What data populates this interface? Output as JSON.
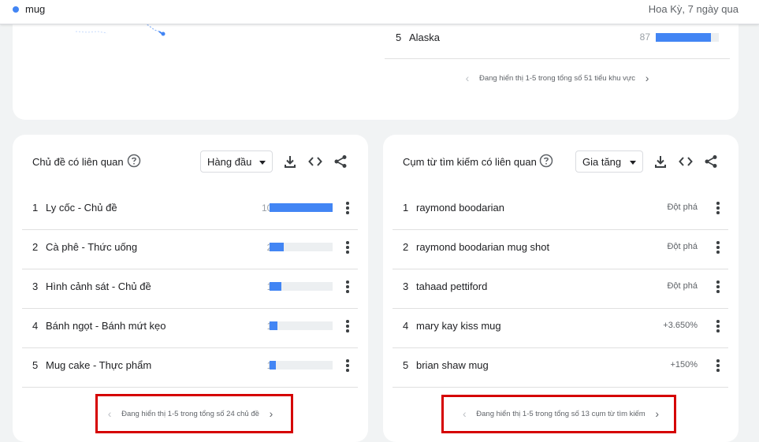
{
  "header": {
    "term": "mug",
    "term_color": "#4285f4",
    "region_time": "Hoa Kỳ, 7 ngày qua"
  },
  "regions": {
    "visible_row": {
      "rank": "5",
      "name": "Alaska",
      "value": "87",
      "fill_percent": 87
    },
    "pager": {
      "prev_icon": "‹",
      "text": "Đang hiển thị 1-5 trong tổng số 51 tiểu khu vực",
      "next_icon": "›"
    }
  },
  "related_topics": {
    "title": "Chủ đề có liên quan",
    "dropdown": "Hàng đầu",
    "rows": [
      {
        "rank": "1",
        "label": "Ly cốc - Chủ đề",
        "value": "100",
        "fill_percent": 100
      },
      {
        "rank": "2",
        "label": "Cà phê - Thức uống",
        "value": "22",
        "fill_percent": 22
      },
      {
        "rank": "3",
        "label": "Hình cảnh sát - Chủ đề",
        "value": "19",
        "fill_percent": 19
      },
      {
        "rank": "4",
        "label": "Bánh ngọt - Bánh mứt kẹo",
        "value": "12",
        "fill_percent": 12
      },
      {
        "rank": "5",
        "label": "Mug cake - Thực phẩm",
        "value": "10",
        "fill_percent": 10
      }
    ],
    "pager": {
      "prev_icon": "‹",
      "text": "Đang hiển thị 1-5 trong tổng số 24 chủ đề",
      "next_icon": "›"
    }
  },
  "related_queries": {
    "title": "Cụm từ tìm kiếm có liên quan",
    "dropdown": "Gia tăng",
    "rows": [
      {
        "rank": "1",
        "label": "raymond boodarian",
        "value": "Đột phá"
      },
      {
        "rank": "2",
        "label": "raymond boodarian mug shot",
        "value": "Đột phá"
      },
      {
        "rank": "3",
        "label": "tahaad pettiford",
        "value": "Đột phá"
      },
      {
        "rank": "4",
        "label": "mary kay kiss mug",
        "value": "+3.650%"
      },
      {
        "rank": "5",
        "label": "brian shaw mug",
        "value": "+150%"
      }
    ],
    "pager": {
      "prev_icon": "‹",
      "text": "Đang hiển thị 1-5 trong tổng số 13 cụm từ tìm kiếm",
      "next_icon": "›"
    }
  },
  "colors": {
    "bar_fill": "#4285f4",
    "highlight": "#d50000"
  }
}
